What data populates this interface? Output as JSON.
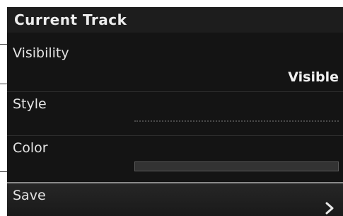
{
  "header": {
    "title": "Current Track"
  },
  "settings": {
    "visibility": {
      "label": "Visibility",
      "value": "Visible"
    },
    "style": {
      "label": "Style"
    },
    "color": {
      "label": "Color"
    },
    "save": {
      "label": "Save"
    }
  },
  "icons": {
    "save_arrow": "chevron-right-icon"
  },
  "colors": {
    "background": "#141414",
    "title_bar": "#1d1d1d",
    "text": "#e4e4e4",
    "divider": "#2e2e2e",
    "save_highlight_border": "#8a8a8a"
  }
}
